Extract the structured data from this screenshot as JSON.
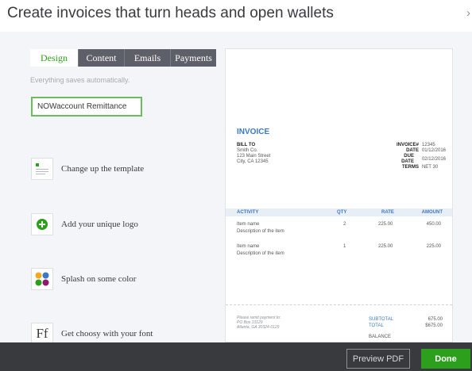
{
  "header": {
    "title": "Create invoices that turn heads and open wallets",
    "close_symbol": "›"
  },
  "tabs": [
    {
      "label": "Design",
      "active": true
    },
    {
      "label": "Content",
      "active": false
    },
    {
      "label": "Emails",
      "active": false
    },
    {
      "label": "Payments",
      "active": false
    }
  ],
  "autosave_note": "Everything saves automatically.",
  "template_name": {
    "value": "NOWaccount Remittance"
  },
  "features": [
    {
      "label": "Change up the template",
      "icon": "template-icon"
    },
    {
      "label": "Add your unique logo",
      "icon": "add-logo-icon"
    },
    {
      "label": "Splash on some color",
      "icon": "color-palette-icon"
    },
    {
      "label": "Get choosy with your font",
      "icon": "font-icon",
      "icon_text": "Ff"
    }
  ],
  "invoice": {
    "title": "INVOICE",
    "bill_to": {
      "heading": "BILL TO",
      "lines": [
        "Smith Co.",
        "123 Main Street",
        "City, CA 12345"
      ]
    },
    "meta": [
      {
        "key": "INVOICE#",
        "value": "12345"
      },
      {
        "key": "DATE",
        "value": "01/12/2016"
      },
      {
        "key": "DUE DATE",
        "value": "02/12/2016"
      },
      {
        "key": "TERMS",
        "value": "NET 30"
      }
    ],
    "columns": [
      "ACTIVITY",
      "QTY",
      "RATE",
      "AMOUNT"
    ],
    "rows": [
      {
        "name": "Item name",
        "desc": "Description of the item",
        "qty": "2",
        "rate": "225.00",
        "amount": "450.00"
      },
      {
        "name": "Item name",
        "desc": "Description of the item",
        "qty": "1",
        "rate": "225.00",
        "amount": "225.00"
      }
    ],
    "remit": [
      "Please remit payment to:",
      "PO Box 13129",
      "Atlanta, GA 30324-0129"
    ],
    "subtotal_label": "SUBTOTAL",
    "subtotal": "675.00",
    "total_label": "TOTAL",
    "total": "$675.00",
    "balance_label": "BALANCE"
  },
  "footer": {
    "preview_label": "Preview PDF",
    "done_label": "Done"
  },
  "colors": {
    "accent": "#2ca01c",
    "invoice_blue": "#3a78c2",
    "footer_bg": "#393a3d"
  }
}
